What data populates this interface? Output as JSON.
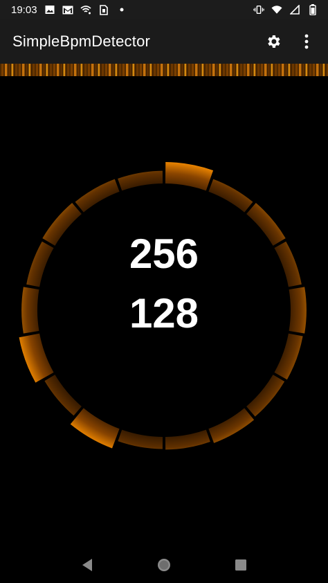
{
  "status_bar": {
    "time": "19:03",
    "left_icons": [
      "image-icon",
      "gmail-icon",
      "wifi-call-icon",
      "sim-icon",
      "dot-icon"
    ],
    "right_icons": [
      "vibrate-icon",
      "wifi-icon",
      "signal-icon",
      "battery-icon"
    ]
  },
  "app_bar": {
    "title": "SimpleBpmDetector",
    "actions": [
      "gear-icon",
      "more-vert-icon"
    ]
  },
  "meter": {
    "bpm_primary": "256",
    "bpm_secondary": "128",
    "accent_color": "#e07b00",
    "segments": [
      {
        "level": 1.0
      },
      {
        "level": 0.35
      },
      {
        "level": 0.45
      },
      {
        "level": 0.35
      },
      {
        "level": 0.55
      },
      {
        "level": 0.45
      },
      {
        "level": 0.35
      },
      {
        "level": 0.5
      },
      {
        "level": 0.3
      },
      {
        "level": 0.25
      },
      {
        "level": 0.95
      },
      {
        "level": 0.25
      },
      {
        "level": 0.95
      },
      {
        "level": 0.55
      },
      {
        "level": 0.35
      },
      {
        "level": 0.45
      },
      {
        "level": 0.35
      },
      {
        "level": 0.3
      }
    ]
  },
  "nav_bar": {
    "buttons": [
      "back-icon",
      "home-icon",
      "recents-icon"
    ]
  }
}
